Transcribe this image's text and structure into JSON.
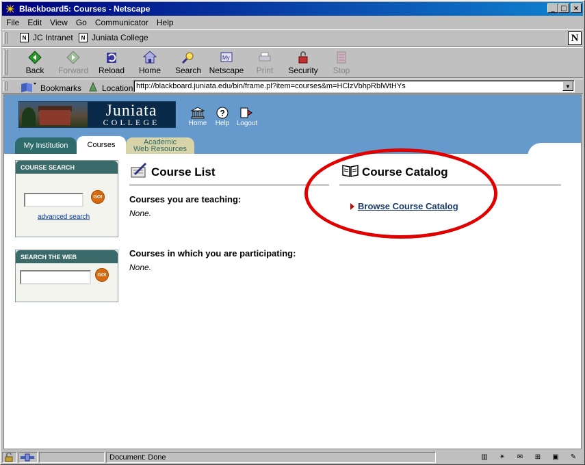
{
  "window": {
    "title": "Blackboard5: Courses - Netscape"
  },
  "menu": [
    "File",
    "Edit",
    "View",
    "Go",
    "Communicator",
    "Help"
  ],
  "personal_toolbar": {
    "links": [
      "JC Intranet",
      "Juniata College"
    ]
  },
  "nav_toolbar": {
    "buttons": [
      {
        "label": "Back",
        "enabled": true,
        "icon": "back-arrow-icon"
      },
      {
        "label": "Forward",
        "enabled": false,
        "icon": "forward-arrow-icon"
      },
      {
        "label": "Reload",
        "enabled": true,
        "icon": "reload-icon"
      },
      {
        "label": "Home",
        "enabled": true,
        "icon": "home-icon"
      },
      {
        "label": "Search",
        "enabled": true,
        "icon": "search-icon"
      },
      {
        "label": "Netscape",
        "enabled": true,
        "icon": "netscape-icon"
      },
      {
        "label": "Print",
        "enabled": false,
        "icon": "print-icon"
      },
      {
        "label": "Security",
        "enabled": true,
        "icon": "lock-icon"
      },
      {
        "label": "Stop",
        "enabled": false,
        "icon": "stop-icon"
      }
    ]
  },
  "location_bar": {
    "bookmarks_label": "Bookmarks",
    "location_label": "Location:",
    "url": "http://blackboard.juniata.edu/bin/frame.pl?item=courses&m=HClzVbhpRblWtHYs"
  },
  "page": {
    "logo": {
      "name": "Juniata",
      "sub": "COLLEGE"
    },
    "top_nav": [
      "Home",
      "Help",
      "Logout"
    ],
    "tabs": {
      "my_institution": "My Institution",
      "courses": "Courses",
      "academic_line1": "Academic",
      "academic_line2": "Web Resources"
    },
    "course_search": {
      "header": "COURSE SEARCH",
      "go_label": "GO!",
      "advanced_link": "advanced search"
    },
    "web_search": {
      "header": "SEARCH THE WEB",
      "go_label": "GO!"
    },
    "course_list": {
      "title": "Course List",
      "teaching_label": "Courses you are teaching:",
      "teaching_value": "None.",
      "participating_label": "Courses in which you are participating:",
      "participating_value": "None."
    },
    "course_catalog": {
      "title": "Course Catalog",
      "link": "Browse Course Catalog"
    }
  },
  "status": {
    "text": "Document: Done"
  },
  "colors": {
    "titlebar": "#000080",
    "banner": "#6699cc",
    "tab_active": "#ffffff",
    "tab_institution": "#2e6b6b",
    "tab_academic": "#d8d4a8",
    "box_header": "#3a6a6a",
    "go_button": "#d86a10",
    "annotation_circle": "#e00000"
  }
}
